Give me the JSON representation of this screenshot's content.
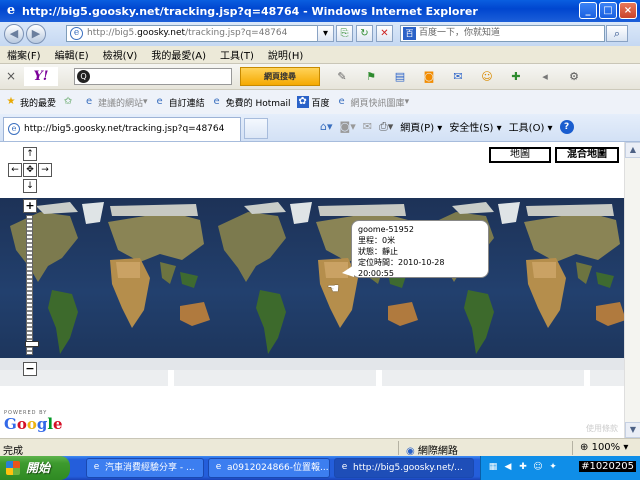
{
  "window": {
    "title": "http://big5.goosky.net/tracking.jsp?q=48764 - Windows Internet Explorer",
    "min": "_",
    "max": "□",
    "close": "×"
  },
  "address": {
    "url_prefix": "http://big5.",
    "url_domain": "goosky.net",
    "url_suffix": "/tracking.jsp?q=48764",
    "dropdown": "▾"
  },
  "search": {
    "placeholder": "百度一下，你就知道",
    "go": "⌕"
  },
  "menu": {
    "items": [
      "檔案(F)",
      "編輯(E)",
      "檢視(V)",
      "我的最愛(A)",
      "工具(T)",
      "說明(H)"
    ]
  },
  "yahoo": {
    "close": "×",
    "logo": "Y!",
    "search_button": "網頁搜尋"
  },
  "favorites": {
    "label": "我的最愛",
    "items": [
      "建議的網站",
      "自訂連結",
      "免費的 Hotmail",
      "百度",
      "網頁快訊圖庫"
    ]
  },
  "tab": {
    "title": "http://big5.goosky.net/tracking.jsp?q=48764"
  },
  "commands": {
    "page": "網頁(P)",
    "safety": "安全性(S)",
    "tools": "工具(O)",
    "help": "?"
  },
  "map": {
    "map_button": "地圖",
    "hybrid_button": "混合地圖",
    "zoom_in": "+",
    "zoom_out": "−",
    "pan_up": "↑",
    "pan_down": "↓",
    "pan_left": "←",
    "pan_right": "→",
    "pan_center": "✥",
    "zoom_level": 0.05,
    "info": {
      "device": "goome-51952",
      "mileage": "里程：0米",
      "status": "狀態：靜止",
      "time": "定位時間：2010-10-28 20:00:55"
    },
    "powered_by": "POWERED BY",
    "google_logo": [
      "G",
      "o",
      "o",
      "g",
      "l",
      "e"
    ],
    "google_colors": [
      "#3369e8",
      "#d50f25",
      "#eeb211",
      "#3369e8",
      "#009925",
      "#d50f25"
    ],
    "terms": "使用條款"
  },
  "status": {
    "text": "完成",
    "zone": "網際網路",
    "zoom": "100%"
  },
  "taskbar": {
    "start": "開始",
    "items": [
      "汽車消費經驗分享 - ...",
      "a0912024866-位置報...",
      "http://big5.goosky.net/..."
    ],
    "clock": "#1020205"
  }
}
